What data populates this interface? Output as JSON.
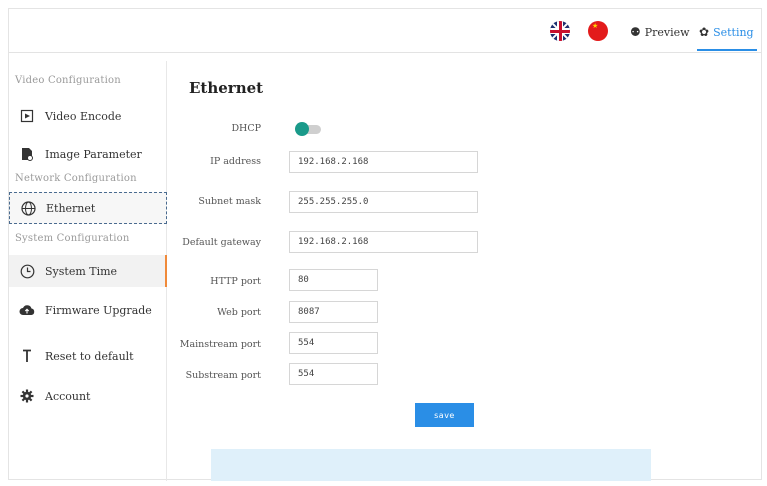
{
  "header": {
    "preview_label": "Preview",
    "setting_label": "Setting",
    "accent_color": "#2a8ee6",
    "flags": [
      "uk-flag-icon",
      "china-flag-icon"
    ]
  },
  "sidebar": {
    "sections": [
      {
        "title": "Video Configuration",
        "items": [
          {
            "label": "Video Encode",
            "icon": "video-encode-icon"
          },
          {
            "label": "Image Parameter",
            "icon": "image-parameter-icon"
          }
        ]
      },
      {
        "title": "Network Configuration",
        "items": [
          {
            "label": "Ethernet",
            "icon": "ethernet-icon"
          }
        ]
      },
      {
        "title": "System Configuration",
        "items": [
          {
            "label": "System Time",
            "icon": "clock-icon"
          },
          {
            "label": "Firmware Upgrade",
            "icon": "cloud-upload-icon"
          },
          {
            "label": "Reset to default",
            "icon": "reset-icon"
          },
          {
            "label": "Account",
            "icon": "gear-icon"
          }
        ]
      }
    ]
  },
  "main": {
    "title": "Ethernet",
    "dhcp": {
      "label": "DHCP",
      "on": true
    },
    "fields": [
      {
        "label": "IP address",
        "value": "192.168.2.168"
      },
      {
        "label": "Subnet mask",
        "value": "255.255.255.0"
      },
      {
        "label": "Default gateway",
        "value": "192.168.2.168"
      },
      {
        "label": "HTTP port",
        "value": "80"
      },
      {
        "label": "Web port",
        "value": "8087"
      },
      {
        "label": "Mainstream port",
        "value": "554"
      },
      {
        "label": "Substream port",
        "value": "554"
      }
    ],
    "save_label": "save"
  }
}
